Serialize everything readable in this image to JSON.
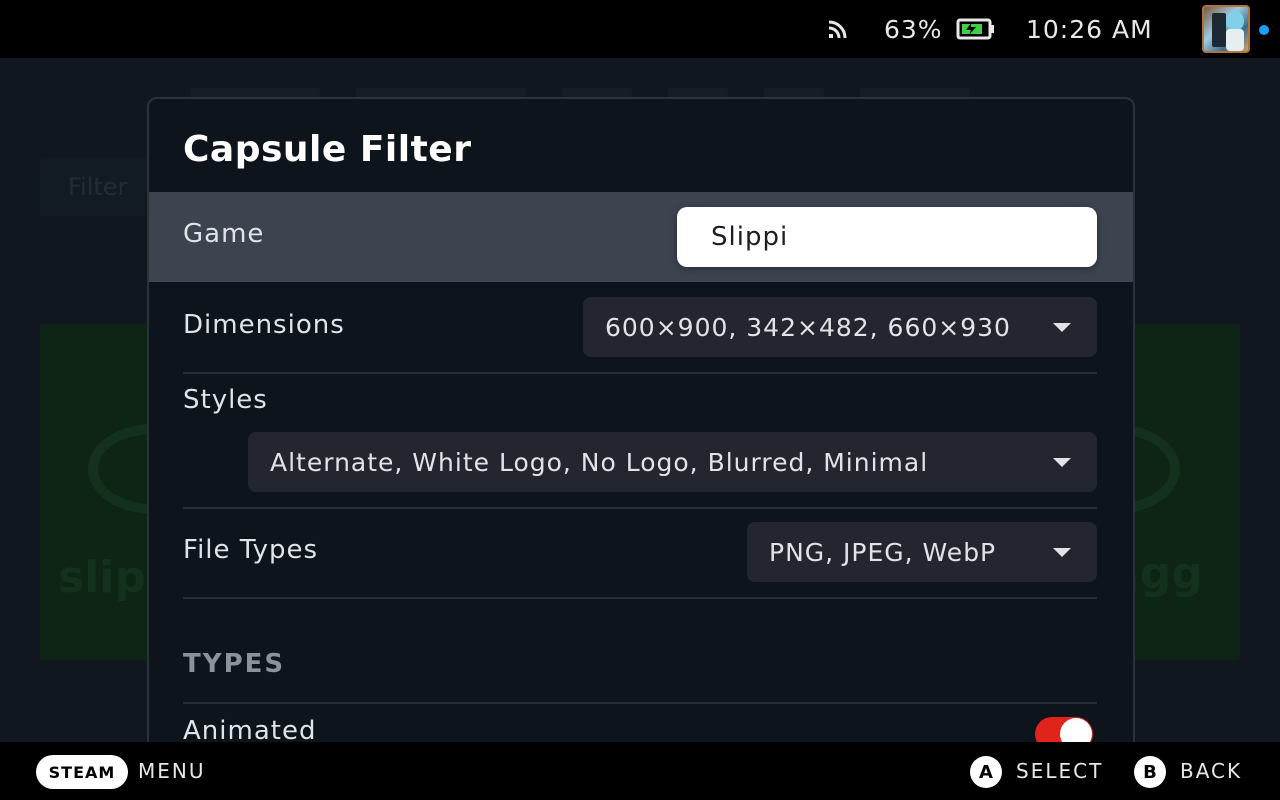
{
  "status_bar": {
    "wifi_icon": "wifi-icon",
    "battery_percent": "63%",
    "battery_icon": "battery-charging-icon",
    "time": "10:26 AM",
    "avatar": "user-avatar",
    "notification_color": "#1a9fff"
  },
  "background": {
    "filter_label": "Filter",
    "card_left_text": "slipp",
    "card_right_text": "i.gg"
  },
  "modal": {
    "title": "Capsule Filter",
    "game": {
      "label": "Game",
      "value": "Slippi"
    },
    "dimensions": {
      "label": "Dimensions",
      "value": "600×900, 342×482, 660×930"
    },
    "styles": {
      "label": "Styles",
      "value": "Alternate, White Logo, No Logo, Blurred, Minimal"
    },
    "file_types": {
      "label": "File Types",
      "value": "PNG, JPEG, WebP"
    },
    "types_section": "TYPES",
    "animated": {
      "label": "Animated",
      "enabled": true,
      "toggle_color": "#e0241c"
    }
  },
  "bottom_bar": {
    "steam_label": "STEAM",
    "menu_label": "MENU",
    "a_glyph": "A",
    "select_label": "SELECT",
    "b_glyph": "B",
    "back_label": "BACK"
  }
}
